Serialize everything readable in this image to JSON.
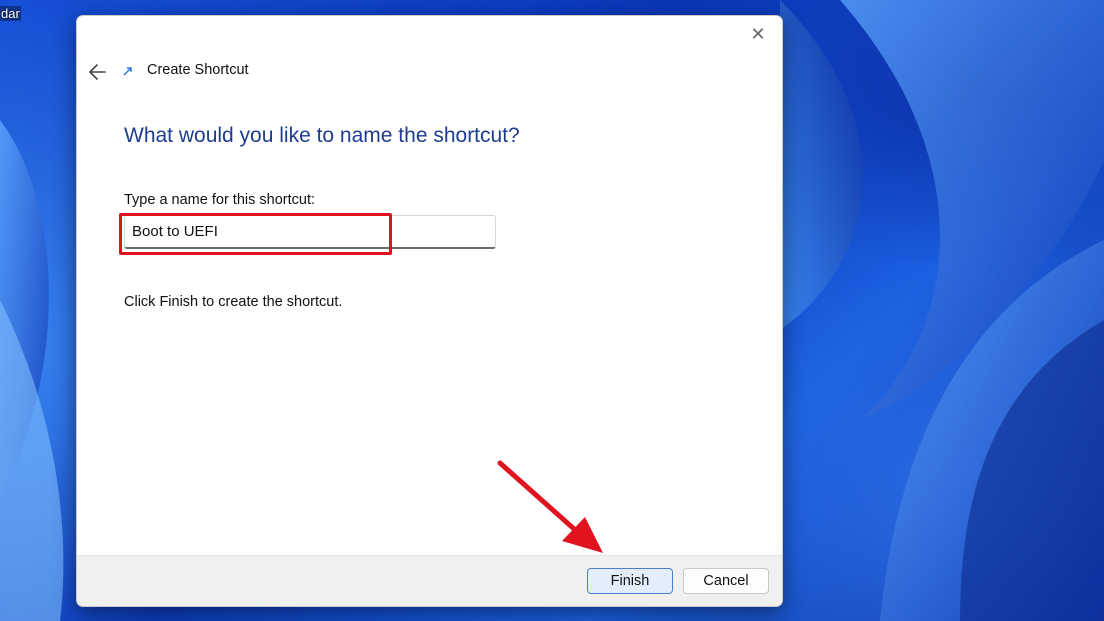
{
  "desktop": {
    "label": "dar"
  },
  "dialog": {
    "title": "Create Shortcut",
    "heading": "What would you like to name the shortcut?",
    "field_label": "Type a name for this shortcut:",
    "name_value": "Boot to UEFI",
    "hint": "Click Finish to create the shortcut.",
    "finish_label": "Finish",
    "cancel_label": "Cancel",
    "close_glyph": "✕"
  },
  "icons": {
    "close": "close-icon",
    "back": "back-arrow-icon",
    "title": "shortcut-icon"
  },
  "colors": {
    "heading": "#1e3d8e",
    "annotation": "#e0141e",
    "primary_button_border": "#4a7ed0"
  }
}
